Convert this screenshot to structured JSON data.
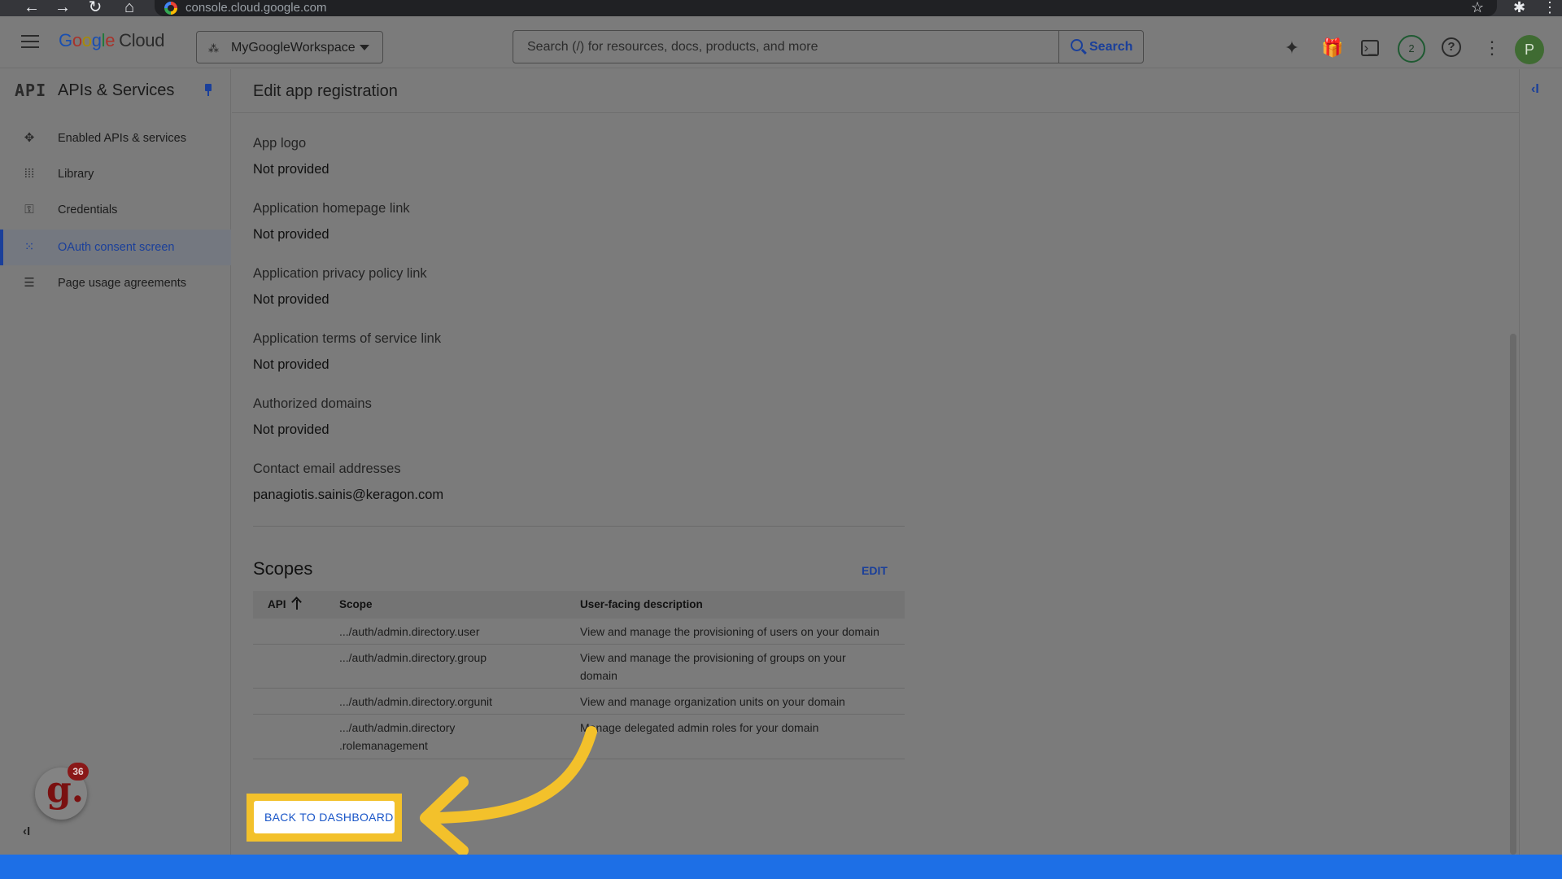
{
  "browser": {
    "url": "console.cloud.google.com"
  },
  "header": {
    "logo_google": "Google",
    "logo_cloud": "Cloud",
    "project_name": "MyGoogleWorkspace",
    "search_placeholder": "Search (/) for resources, docs, products, and more",
    "search_button": "Search",
    "notifications_count": "2",
    "avatar_initial": "P"
  },
  "sidebar": {
    "logo": "API",
    "title": "APIs & Services",
    "items": [
      {
        "label": "Enabled APIs & services",
        "icon": "api-diamond-icon"
      },
      {
        "label": "Library",
        "icon": "library-icon"
      },
      {
        "label": "Credentials",
        "icon": "key-icon"
      },
      {
        "label": "OAuth consent screen",
        "icon": "consent-grid-icon",
        "active": true
      },
      {
        "label": "Page usage agreements",
        "icon": "settings-list-icon"
      }
    ],
    "floating_badge_count": "36"
  },
  "main": {
    "title": "Edit app registration",
    "fields": [
      {
        "label": "App logo",
        "value": "Not provided"
      },
      {
        "label": "Application homepage link",
        "value": "Not provided"
      },
      {
        "label": "Application privacy policy link",
        "value": "Not provided"
      },
      {
        "label": "Application terms of service link",
        "value": "Not provided"
      },
      {
        "label": "Authorized domains",
        "value": "Not provided"
      },
      {
        "label": "Contact email addresses",
        "value": "panagiotis.sainis@keragon.com"
      }
    ],
    "scopes": {
      "title": "Scopes",
      "edit_label": "EDIT",
      "columns": [
        "API",
        "Scope",
        "User-facing description"
      ],
      "rows": [
        {
          "api": "",
          "scope_line1": ".../auth/admin.directory.user",
          "scope_line2": "",
          "desc_line1": "View and manage the provisioning of users on your domain",
          "desc_line2": ""
        },
        {
          "api": "",
          "scope_line1": ".../auth/admin.directory.group",
          "scope_line2": "",
          "desc_line1": "View and manage the provisioning of groups on your",
          "desc_line2": "domain"
        },
        {
          "api": "",
          "scope_line1": ".../auth/admin.directory.orgunit",
          "scope_line2": "",
          "desc_line1": "View and manage organization units on your domain",
          "desc_line2": ""
        },
        {
          "api": "",
          "scope_line1": ".../auth/admin.directory",
          "scope_line2": ".rolemanagement",
          "desc_line1": "Manage delegated admin roles for your domain",
          "desc_line2": ""
        }
      ]
    },
    "back_button": "BACK TO DASHBOARD"
  },
  "colors": {
    "accent": "#1a3f9a",
    "highlight": "#f3c12b",
    "bottom_bar": "#1d6fe6"
  }
}
